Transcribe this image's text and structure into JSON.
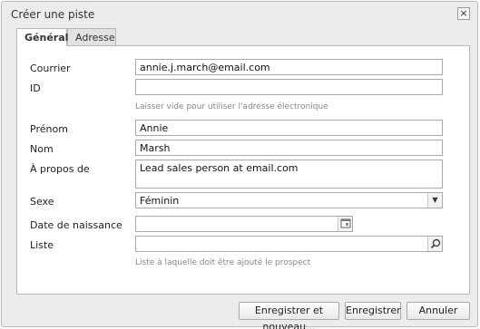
{
  "dialog": {
    "title": "Créer une piste",
    "close_icon": "close-icon"
  },
  "tabs": [
    {
      "label": "Général",
      "active": true
    },
    {
      "label": "Adresse",
      "active": false
    }
  ],
  "form": {
    "email": {
      "label": "Courrier",
      "value": "annie.j.march@email.com"
    },
    "id": {
      "label": "ID",
      "value": "",
      "hint": "Laisser vide pour utiliser l'adresse électronique"
    },
    "first_name": {
      "label": "Prénom",
      "value": "Annie"
    },
    "last_name": {
      "label": "Nom",
      "value": "Marsh"
    },
    "about": {
      "label": "À propos de",
      "value": "Lead sales person at email.com"
    },
    "gender": {
      "label": "Sexe",
      "value": "Féminin",
      "icon": "chevron-down-icon"
    },
    "birthdate": {
      "label": "Date de naissance",
      "value": "",
      "icon": "calendar-icon"
    },
    "list": {
      "label": "Liste",
      "value": "",
      "icon": "search-icon",
      "hint": "Liste à laquelle doit être ajouté le prospect"
    }
  },
  "footer": {
    "save_new_label": "Enregistrer et nouveau...",
    "save_label": "Enregistrer",
    "cancel_label": "Annuler"
  }
}
